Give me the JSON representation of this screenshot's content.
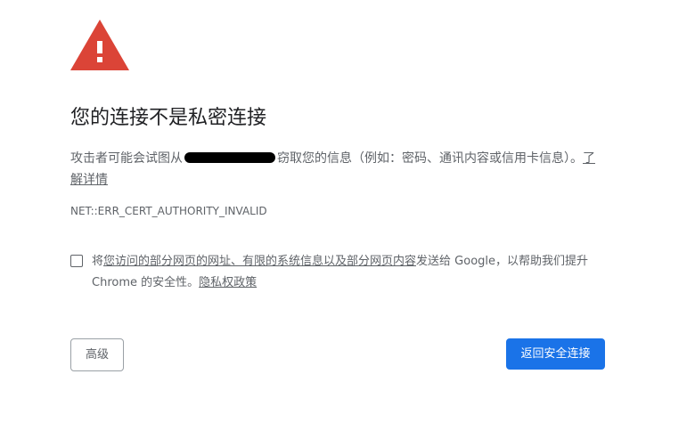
{
  "icon": "warning-triangle-icon",
  "colors": {
    "warning_red": "#db4437",
    "primary_button": "#1a73e8",
    "text_primary": "#202124",
    "text_secondary": "#5f6368"
  },
  "title": "您的连接不是私密连接",
  "explanation": {
    "prefix": "攻击者可能会试图从",
    "suffix": "窃取您的信息（例如：密码、通讯内容或信用卡信息）。",
    "learn_more_link": "了解详情"
  },
  "error_code": "NET::ERR_CERT_AUTHORITY_INVALID",
  "optin": {
    "prefix": "将",
    "link": "您访问的部分网页的网址、有限的系统信息以及部分网页内容",
    "middle": "发送给 Google，以帮助我们提升 Chrome 的安全性。",
    "privacy_link": "隐私权政策",
    "checked": false
  },
  "buttons": {
    "advanced": "高级",
    "back_to_safety": "返回安全连接"
  }
}
